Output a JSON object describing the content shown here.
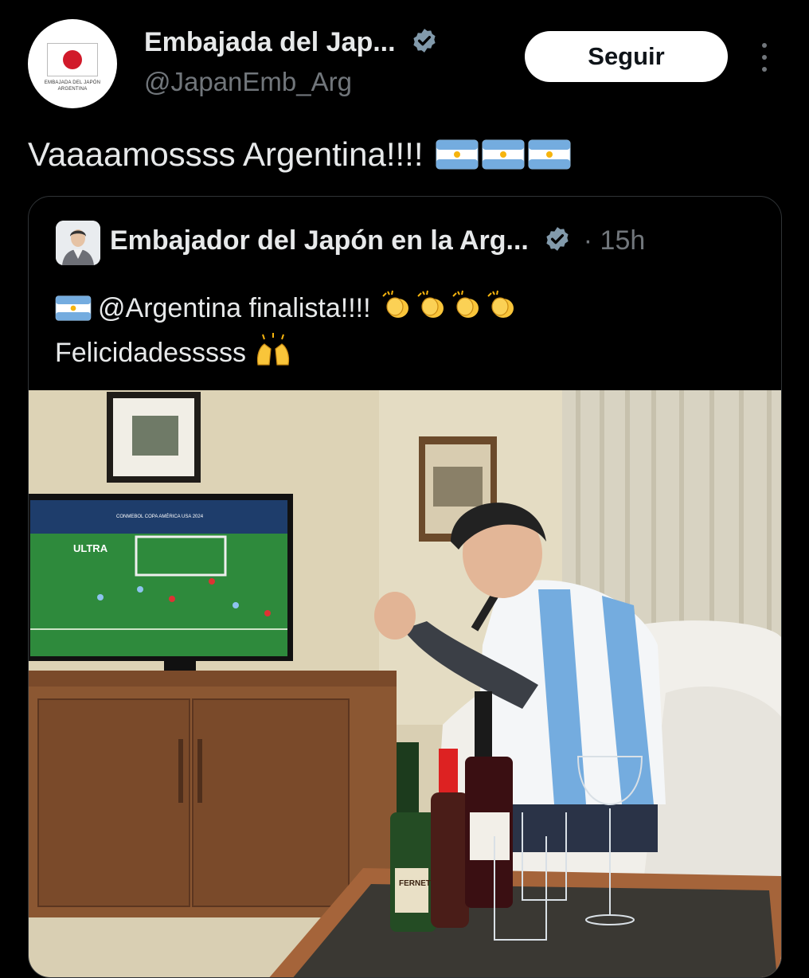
{
  "header": {
    "account_name": "Embajada del Jap...",
    "handle": "@JapanEmb_Arg",
    "follow_label": "Seguir",
    "avatar_caption_line1": "EMBAJADA DEL JAPÓN",
    "avatar_caption_line2": "ARGENTINA"
  },
  "tweet": {
    "text": "Vaaaamossss Argentina!!!!"
  },
  "quoted": {
    "author_name": "Embajador del Japón en la Arg...",
    "time": "· 15h",
    "line1": "@Argentina finalista!!!!",
    "line2": "Felicidadesssss"
  },
  "media": {
    "tv_label": "ULTRA",
    "tv_banner": "CONMEBOL COPA AMÉRICA USA 2024",
    "bottle_label": "FERNET"
  },
  "icons": {
    "verified": "verified-badge-icon",
    "more": "more-dots-icon",
    "flag": "argentina-flag-icon",
    "clap": "clapping-hands-icon",
    "raise": "raising-hands-icon"
  },
  "colors": {
    "background": "#000000",
    "text": "#e7e9ea",
    "secondary": "#71767b",
    "verified": "#829aab",
    "border": "#2f3336",
    "japan_red": "#d11a2a",
    "argentina_blue": "#74acdf"
  }
}
